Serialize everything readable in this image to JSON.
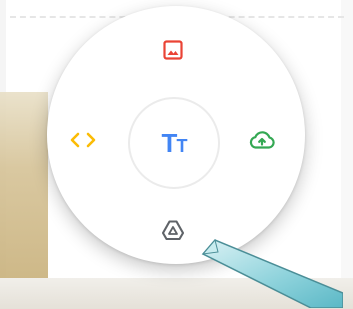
{
  "radial_menu": {
    "center": {
      "label_large": "T",
      "label_small": "T"
    },
    "options": {
      "top": {
        "icon": "image-icon"
      },
      "left": {
        "icon": "embed-code-icon"
      },
      "right": {
        "icon": "cloud-upload-icon"
      },
      "bottom": {
        "icon": "google-drive-icon"
      }
    }
  },
  "colors": {
    "image": "#ea4335",
    "embed": "#fbbc05",
    "upload": "#34a853",
    "drive": "#5f6368",
    "text": "#4285f4"
  }
}
